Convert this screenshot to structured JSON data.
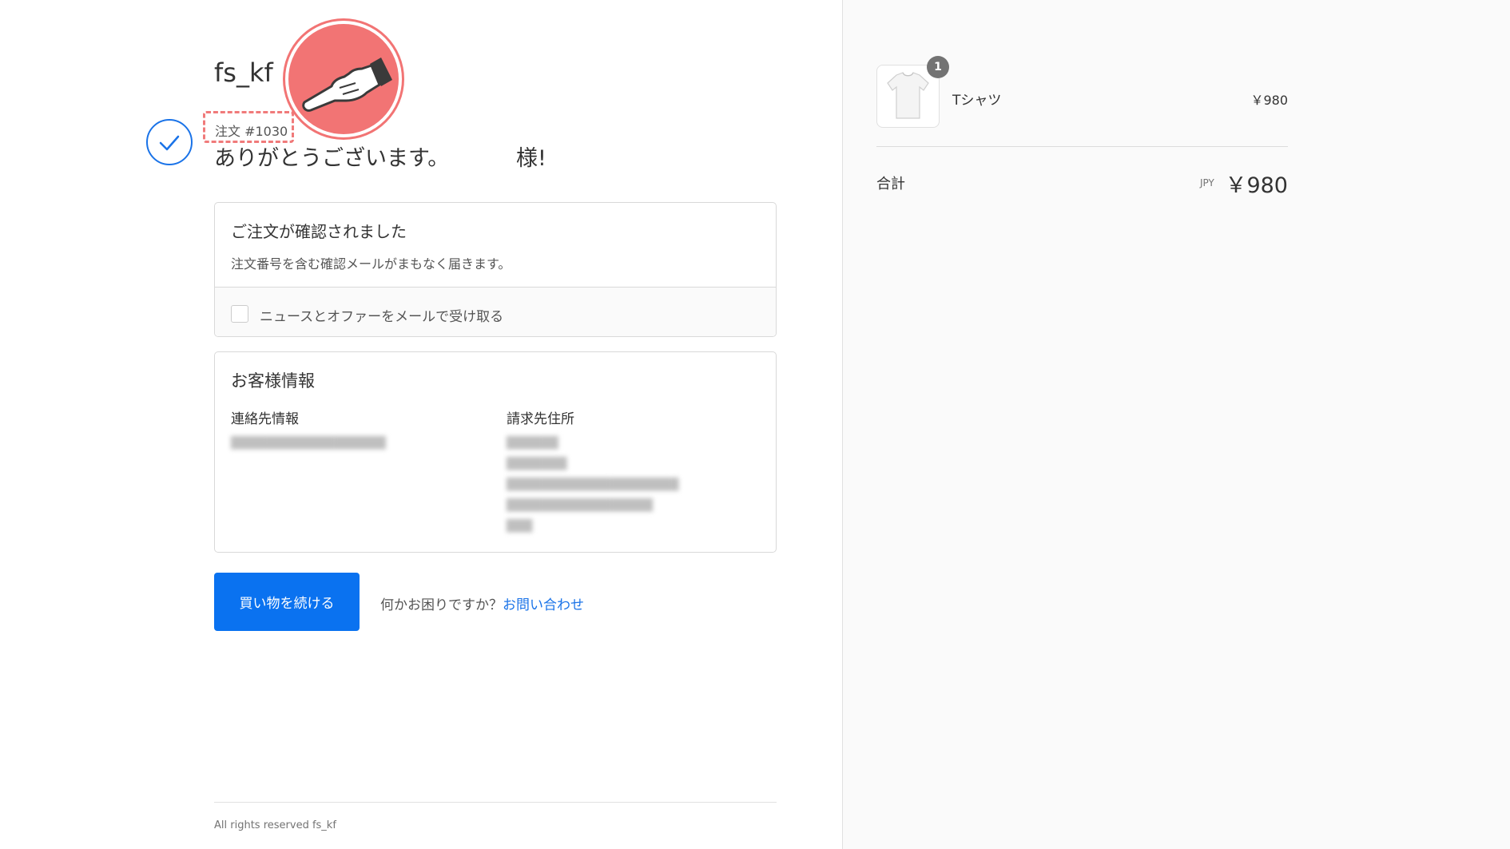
{
  "shop": {
    "name": "fs_kf"
  },
  "order": {
    "number_label": "注文 #1030",
    "thanks_text": "ありがとうございます。",
    "thanks_suffix": "様!"
  },
  "confirm_card": {
    "title": "ご注文が確認されました",
    "subtitle": "注文番号を含む確認メールがまもなく届きます。",
    "newsletter_label": "ニュースとオファーをメールで受け取る"
  },
  "customer_card": {
    "title": "お客様情報",
    "contact_heading": "連絡先情報",
    "billing_heading": "請求先住所"
  },
  "actions": {
    "continue_label": "買い物を続ける",
    "help_text": "何かお困りですか？",
    "help_link": "お問い合わせ"
  },
  "footer": {
    "text": "All rights reserved fs_kf"
  },
  "cart": {
    "items": [
      {
        "name": "Tシャツ",
        "price": "￥980",
        "quantity": "1"
      }
    ],
    "total_label": "合計",
    "total_currency": "JPY",
    "total_amount": "￥980"
  },
  "colors": {
    "accent": "#0a72f0",
    "link": "#1a73e8",
    "highlight": "#f27474"
  }
}
